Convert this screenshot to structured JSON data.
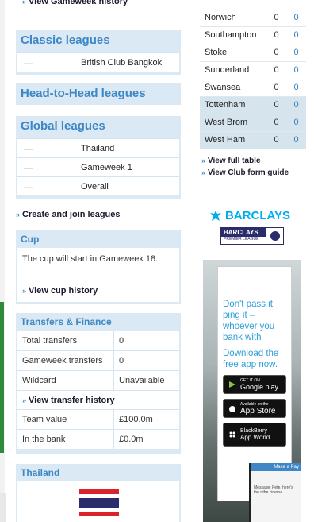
{
  "left": {
    "gameweek_history_link": "View Gameweek history",
    "classic": {
      "title": "Classic leagues",
      "rows": [
        {
          "rank": "—",
          "name": "British Club Bangkok"
        }
      ]
    },
    "h2h": {
      "title": "Head-to-Head leagues"
    },
    "global": {
      "title": "Global leagues",
      "rows": [
        {
          "rank": "—",
          "name": "Thailand"
        },
        {
          "rank": "—",
          "name": "Gameweek 1"
        },
        {
          "rank": "—",
          "name": "Overall"
        }
      ]
    },
    "create_join_link": "Create and join leagues",
    "cup": {
      "title": "Cup",
      "text": "The cup will start in Gameweek 18.",
      "link": "View cup history"
    },
    "transfers": {
      "title": "Transfers & Finance",
      "rows": [
        {
          "k": "Total transfers",
          "v": "0"
        },
        {
          "k": "Gameweek transfers",
          "v": "0"
        },
        {
          "k": "Wildcard",
          "v": "Unavailable"
        }
      ],
      "link": "View transfer history",
      "rows2": [
        {
          "k": "Team value",
          "v": "£100.0m"
        },
        {
          "k": "In the bank",
          "v": "£0.0m"
        }
      ]
    },
    "country": {
      "title": "Thailand"
    }
  },
  "right": {
    "table": [
      {
        "team": "Norwich",
        "a": "0",
        "b": "0",
        "hl": false
      },
      {
        "team": "Southampton",
        "a": "0",
        "b": "0",
        "hl": false
      },
      {
        "team": "Stoke",
        "a": "0",
        "b": "0",
        "hl": false
      },
      {
        "team": "Sunderland",
        "a": "0",
        "b": "0",
        "hl": false
      },
      {
        "team": "Swansea",
        "a": "0",
        "b": "0",
        "hl": false
      },
      {
        "team": "Tottenham",
        "a": "0",
        "b": "0",
        "hl": true
      },
      {
        "team": "West Brom",
        "a": "0",
        "b": "0",
        "hl": true
      },
      {
        "team": "West Ham",
        "a": "0",
        "b": "0",
        "hl": true
      }
    ],
    "full_table_link": "View full table",
    "form_guide_link": "View Club form guide"
  },
  "ad": {
    "brand": "BARCLAYS",
    "sub_brand": "BARCLAYS",
    "sub_caption": "PREMIER LEAGUE",
    "headline": "Don't pass it, ping it – whoever you bank with",
    "cta": "Download the free app now.",
    "store1_small": "GET IT ON",
    "store1": "Google play",
    "store2_small": "Available on the",
    "store2": "App Store",
    "store3_small": "BlackBerry",
    "store3": "App World.",
    "phone_bar": "Make a Pay",
    "phone_msg": "Message: Pete, here's the r the cinema"
  },
  "colors": {
    "accent": "#3d87c6",
    "panel": "#dbe9f4",
    "barclays_blue": "#00aeef"
  }
}
